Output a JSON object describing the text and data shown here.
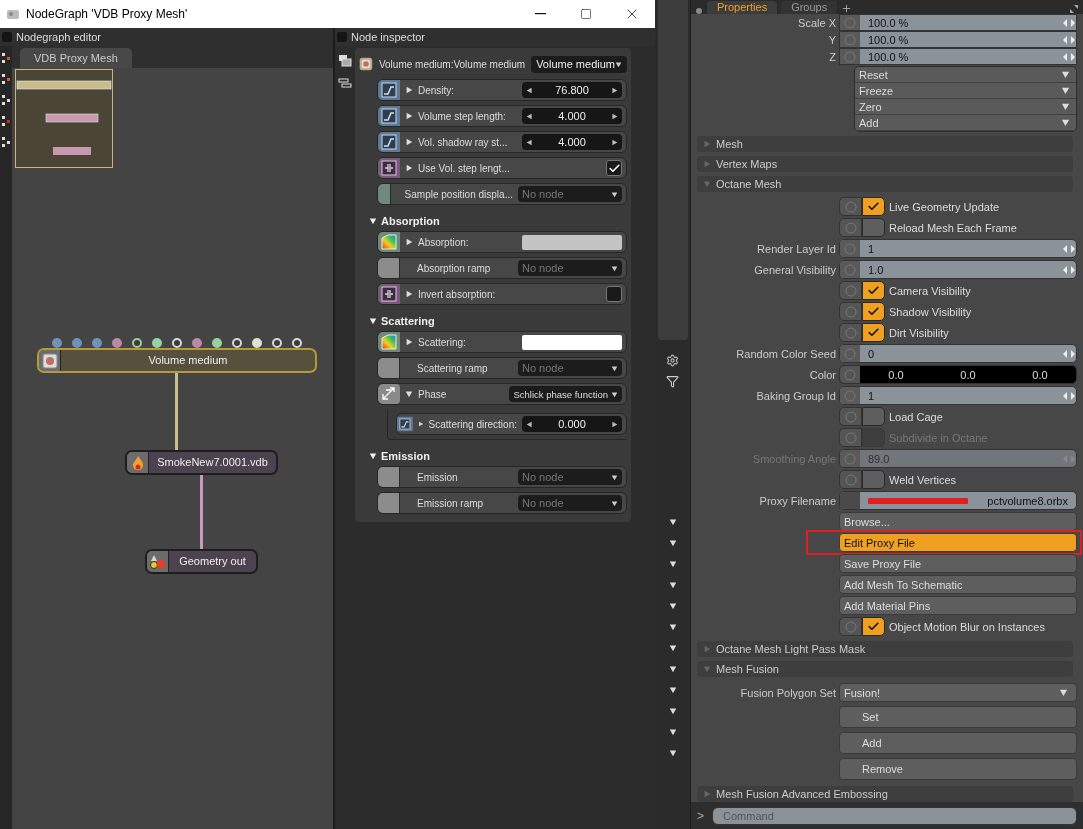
{
  "window": {
    "title": "NodeGraph 'VDB Proxy Mesh'"
  },
  "nodegraph": {
    "title": "Nodegraph editor",
    "tab": "VDB Proxy Mesh",
    "nodes": [
      {
        "kind": "medium",
        "label": "Volume medium",
        "selected": true,
        "pins": [
          {
            "color": "#6f93b8",
            "filled": true
          },
          {
            "color": "#6f93b8",
            "filled": true
          },
          {
            "color": "#6f93b8",
            "filled": true
          },
          {
            "color": "#b88aa8",
            "filled": true
          },
          {
            "color": "#9fc9a0",
            "filled": false
          },
          {
            "color": "#98d0a4",
            "filled": true
          },
          {
            "color": "#d8d8d8",
            "filled": false
          },
          {
            "color": "#b88aa8",
            "filled": true
          },
          {
            "color": "#98d0a4",
            "filled": true
          },
          {
            "color": "#d8d8d8",
            "filled": false
          },
          {
            "color": "#e0e0d0",
            "filled": true
          },
          {
            "color": "#d8d8d8",
            "filled": false
          },
          {
            "color": "#d8d8d8",
            "filled": false
          }
        ]
      },
      {
        "kind": "vdb",
        "label": "SmokeNew7.0001.vdb",
        "selected": false
      },
      {
        "kind": "output",
        "label": "Geometry out",
        "selected": false
      }
    ]
  },
  "inspector": {
    "title": "Node inspector",
    "header": {
      "label": "Volume medium:Volume medium",
      "value": "Volume medium"
    },
    "groups": [
      {
        "rows": [
          {
            "kind": "number",
            "label": "Density:",
            "value": "76.800"
          },
          {
            "kind": "number",
            "label": "Volume step length:",
            "value": "4.000"
          },
          {
            "kind": "number",
            "label": "Vol. shadow ray st...",
            "value": "4.000"
          },
          {
            "kind": "checkbox",
            "label": "Use Vol. step lengt...",
            "checked": true
          },
          {
            "kind": "node",
            "label": "Sample position displa...",
            "value": "No node",
            "color": "#6f8a7a"
          }
        ]
      },
      {
        "title": "Absorption",
        "expanded": true,
        "rows": [
          {
            "kind": "color",
            "label": "Absorption:",
            "color": "#c4c4c4"
          },
          {
            "kind": "node",
            "label": "Absorption ramp",
            "value": "No node",
            "color": "#8c8c8c"
          },
          {
            "kind": "checkbox",
            "label": "Invert absorption:",
            "checked": false
          }
        ]
      },
      {
        "title": "Scattering",
        "expanded": true,
        "rows": [
          {
            "kind": "color",
            "label": "Scattering:",
            "color": "#ffffff"
          },
          {
            "kind": "node",
            "label": "Scattering ramp",
            "value": "No node",
            "color": "#8c8c8c"
          },
          {
            "kind": "enum",
            "label": "Phase",
            "value": "Schlick phase function",
            "expanded": true,
            "children": [
              {
                "kind": "number",
                "label": "Scattering direction:",
                "value": "0.000"
              }
            ]
          }
        ]
      },
      {
        "title": "Emission",
        "expanded": true,
        "rows": [
          {
            "kind": "node",
            "label": "Emission",
            "value": "No node",
            "color": "#8c8c8c"
          },
          {
            "kind": "node",
            "label": "Emission ramp",
            "value": "No node",
            "color": "#8c8c8c"
          }
        ]
      }
    ]
  },
  "properties": {
    "tabs": [
      {
        "label": "Properties",
        "selected": true
      },
      {
        "label": "Groups",
        "selected": false
      }
    ],
    "transform": [
      {
        "label": "Scale X",
        "value": "100.0 %"
      },
      {
        "label": "Y",
        "value": "100.0 %"
      },
      {
        "label": "Z",
        "value": "100.0 %"
      }
    ],
    "actions": [
      "Reset",
      "Freeze",
      "Zero",
      "Add"
    ],
    "sections": [
      {
        "title": "Mesh",
        "expanded": false
      },
      {
        "title": "Vertex Maps",
        "expanded": false
      },
      {
        "title": "Octane Mesh",
        "expanded": true,
        "rows": [
          {
            "kind": "toggle",
            "label": "Live Geometry Update",
            "checked": true,
            "disabled": false
          },
          {
            "kind": "toggle",
            "label": "Reload Mesh Each Frame",
            "checked": false,
            "disabled": false
          },
          {
            "kind": "number",
            "label": "Render Layer Id",
            "value": "1",
            "disabled": false
          },
          {
            "kind": "number",
            "label": "General Visibility",
            "value": "1.0",
            "disabled": false
          },
          {
            "kind": "toggle",
            "label": "Camera Visibility",
            "checked": true,
            "disabled": false
          },
          {
            "kind": "toggle",
            "label": "Shadow Visibility",
            "checked": true,
            "disabled": false
          },
          {
            "kind": "toggle",
            "label": "Dirt Visibility",
            "checked": true,
            "disabled": false
          },
          {
            "kind": "number",
            "label": "Random Color Seed",
            "value": "0",
            "disabled": false
          },
          {
            "kind": "color",
            "label": "Color",
            "values": [
              "0.0",
              "0.0",
              "0.0"
            ]
          },
          {
            "kind": "number",
            "label": "Baking Group Id",
            "value": "1",
            "disabled": false
          },
          {
            "kind": "toggle",
            "label": "Load Cage",
            "checked": false,
            "disabled": false
          },
          {
            "kind": "toggle",
            "label": "Subdivide in Octane",
            "checked": false,
            "disabled": true
          },
          {
            "kind": "number",
            "label": "Smoothing Angle",
            "value": "89.0",
            "disabled": true
          },
          {
            "kind": "toggle",
            "label": "Weld Vertices",
            "checked": false,
            "disabled": false
          },
          {
            "kind": "file",
            "label": "Proxy Filename",
            "value": "pctvolume8.orbx",
            "redacted": true
          },
          {
            "kind": "button",
            "label": "Browse...",
            "highlighted": false
          },
          {
            "kind": "button",
            "label": "Edit Proxy File",
            "highlighted": true
          },
          {
            "kind": "button",
            "label": "Save Proxy File",
            "highlighted": false
          },
          {
            "kind": "button",
            "label": "Add Mesh To Schematic",
            "highlighted": false
          },
          {
            "kind": "button",
            "label": "Add Material Pins",
            "highlighted": false
          },
          {
            "kind": "toggle",
            "label": "Object Motion Blur on Instances",
            "checked": true,
            "disabled": false
          }
        ]
      },
      {
        "title": "Octane Mesh Light Pass Mask",
        "expanded": false
      },
      {
        "title": "Mesh Fusion",
        "expanded": true,
        "rows": [
          {
            "kind": "dropdown",
            "label": "Fusion Polygon Set",
            "value": "Fusion!"
          },
          {
            "kind": "action",
            "label": "Set"
          },
          {
            "kind": "action",
            "label": "Add"
          },
          {
            "kind": "action",
            "label": "Remove"
          }
        ]
      },
      {
        "title": "Mesh Fusion Advanced Embossing",
        "expanded": false
      }
    ],
    "command": {
      "prompt": ">",
      "placeholder": "Command"
    }
  }
}
